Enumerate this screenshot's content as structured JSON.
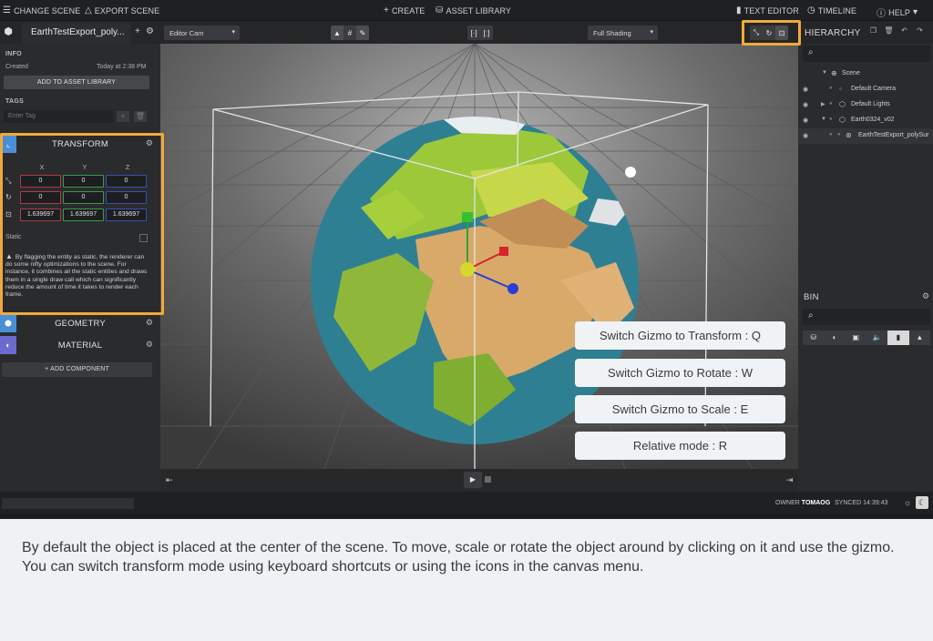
{
  "menubar": {
    "change_scene": "CHANGE SCENE",
    "export_scene": "EXPORT SCENE",
    "create": "CREATE",
    "asset_library": "ASSET LIBRARY",
    "text_editor": "TEXT EDITOR",
    "timeline": "TIMELINE",
    "help": "HELP"
  },
  "toolbar": {
    "document_tab": "EarthTestExport_poly...",
    "camera_select": "Editor Cam",
    "shading_select": "Full Shading"
  },
  "hierarchy": {
    "title": "HIERARCHY",
    "items": [
      {
        "label": "Scene",
        "icon": "globe-icon"
      },
      {
        "label": "Default Camera",
        "icon": "dot-icon"
      },
      {
        "label": "Default Lights",
        "icon": "hexagon-icon"
      },
      {
        "label": "Earth0324_v02",
        "icon": "hexagon-icon"
      },
      {
        "label": "EarthTestExport_polySur",
        "icon": "object-icon"
      }
    ]
  },
  "bin": {
    "title": "BIN"
  },
  "inspector": {
    "info_label": "INFO",
    "created_label": "Created",
    "created_value": "Today at 2:38 PM",
    "add_to_library": "ADD TO ASSET LIBRARY",
    "tags_label": "TAGS",
    "tag_placeholder": "Enter Tag",
    "transform": {
      "title": "TRANSFORM",
      "axes": [
        "X",
        "Y",
        "Z"
      ],
      "position": [
        "0",
        "0",
        "0"
      ],
      "rotation": [
        "0",
        "0",
        "0"
      ],
      "scale": [
        "1.639697",
        "1.639697",
        "1.639697"
      ],
      "static_label": "Static",
      "static_info": "By flagging the entity as static, the renderer can do some nifty optimizations to the scene. For instance, it combines all the static entities and draws them in a single draw call which can significantly reduce the amount of time it takes to render each frame."
    },
    "geometry_title": "GEOMETRY",
    "material_title": "MATERIAL",
    "add_component": "ADD COMPONENT"
  },
  "tips": [
    "Switch Gizmo to Transform : Q",
    "Switch Gizmo to Rotate : W",
    "Switch Gizmo to Scale : E",
    "Relative mode : R"
  ],
  "status": {
    "owner_label": "OWNER",
    "owner_name": "TOMAOG",
    "synced": "SYNCED 14:39:43"
  },
  "colors": {
    "highlight": "#f2a93b",
    "accent_blue": "#4a8fd6",
    "axis_x": "#b13a48",
    "axis_y": "#3a9b48",
    "axis_z": "#3b4fb1"
  },
  "caption": "By default the object is placed at the center of the scene. To move, scale or rotate the object around by clicking on it and use the gizmo. You can switch transform mode using keyboard shortcuts or using the icons in the canvas menu."
}
